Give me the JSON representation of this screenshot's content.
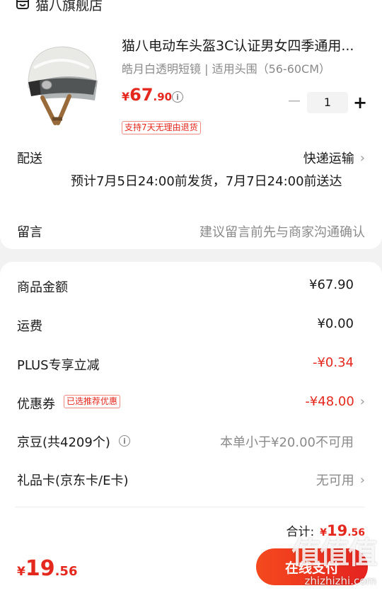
{
  "shop": {
    "name": "猫八旗舰店",
    "icon": "store-icon"
  },
  "product": {
    "title": "猫八电动车头盔3C认证男女四季通用...",
    "spec": "皓月白透明短镜 | 适用头围（56-60CM）",
    "price_currency": "¥",
    "price_int": "67",
    "price_dec": ".90",
    "info_icon": "i",
    "quantity": "1",
    "minus_label": "－",
    "plus_label": "+",
    "badge": "支持7天无理由退货"
  },
  "delivery": {
    "label": "配送",
    "method": "快递运输",
    "estimate": "预计7月5日24:00前发货，7月7日24:00前送达"
  },
  "message": {
    "label": "留言",
    "placeholder": "建议留言前先与商家沟通确认"
  },
  "summary": {
    "goods_label": "商品金额",
    "goods_value": "¥67.90",
    "shipping_label": "运费",
    "shipping_value": "¥0.00",
    "plus_label": "PLUS专享立减",
    "plus_value": "-¥0.34",
    "coupon_label": "优惠券",
    "coupon_badge": "已选推荐优惠",
    "coupon_value": "-¥48.00",
    "beans_label": "京豆(共4209个)",
    "beans_value": "本单小于¥20.00不可用",
    "gift_label": "礼品卡(京东卡/E卡)",
    "gift_value": "无可用",
    "total_label": "合计:",
    "total_currency": "¥",
    "total_int": "19",
    "total_dec": ".56"
  },
  "bottom_bar": {
    "price_currency": "¥",
    "price_int": "19",
    "price_dec": ".56",
    "pay_button": "在线支付"
  },
  "watermark": {
    "chars": "值值值",
    "url": "zhizhizhi.com"
  },
  "colors": {
    "accent_red": "#e5281e",
    "pay_gradient_start": "#f4491e",
    "pay_gradient_end": "#e52320"
  }
}
